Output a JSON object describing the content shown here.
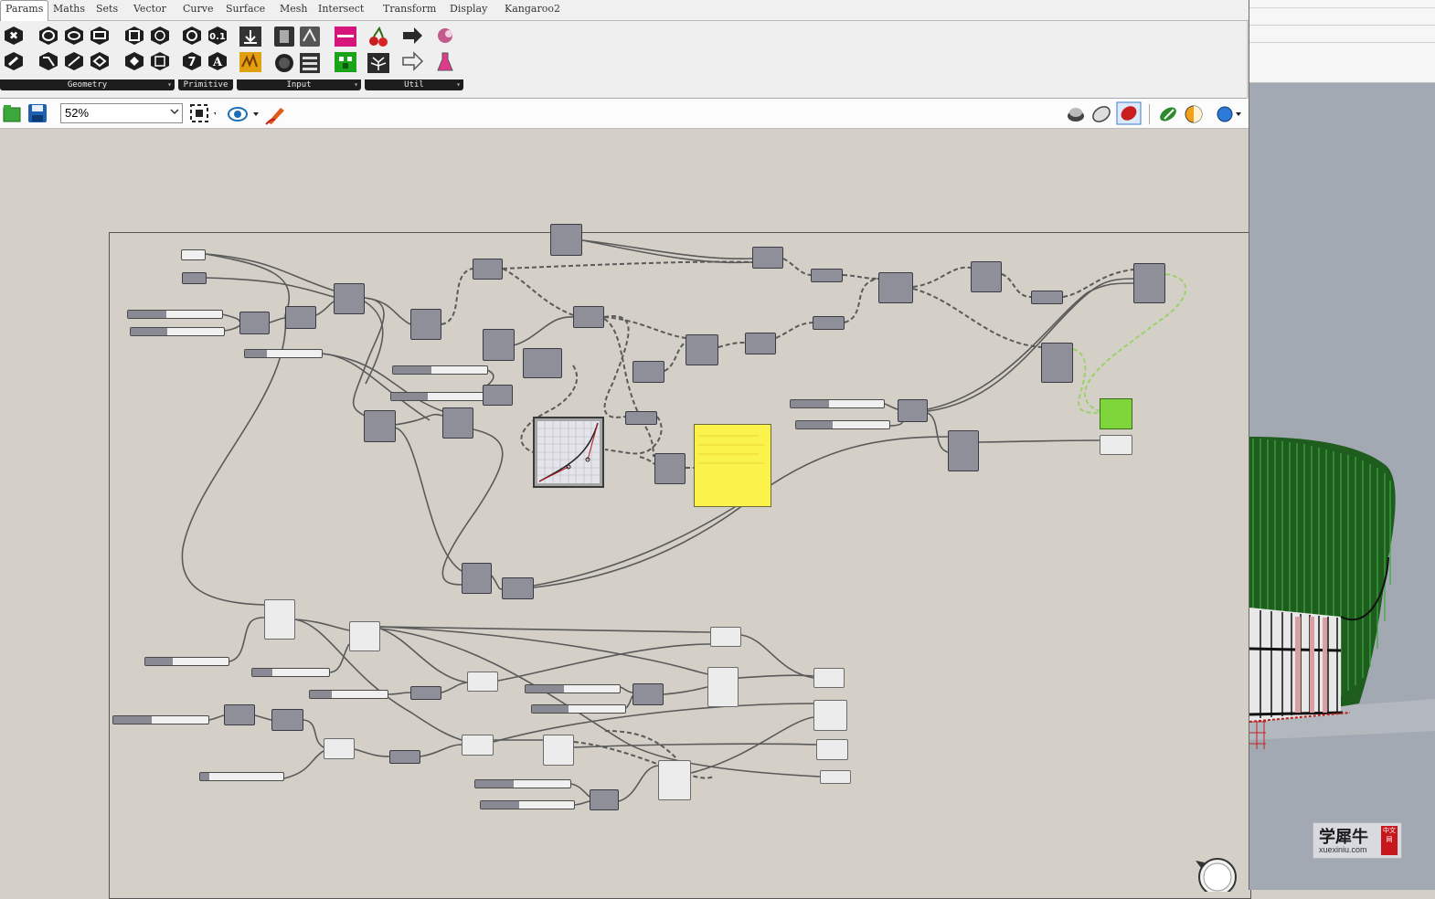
{
  "tabs": [
    {
      "label": "Params",
      "active": true
    },
    {
      "label": "Maths"
    },
    {
      "label": "Sets"
    },
    {
      "label": "Vector"
    },
    {
      "label": "Curve"
    },
    {
      "label": "Surface"
    },
    {
      "label": "Mesh"
    },
    {
      "label": "Intersect"
    },
    {
      "label": "Transform"
    },
    {
      "label": "Display"
    },
    {
      "label": "Kangaroo2"
    }
  ],
  "ribbon_panels": [
    {
      "label": "Geometry"
    },
    {
      "label": "Primitive"
    },
    {
      "label": "Input"
    },
    {
      "label": "Util"
    }
  ],
  "primitive_icons": {
    "number": "0.1",
    "integer": "7",
    "text": "A"
  },
  "toolbar": {
    "zoom_value": "52%",
    "icons": [
      "open-file-icon",
      "save-file-icon",
      "zoom-extents-icon",
      "preview-eye-icon",
      "sketch-pen-icon",
      "preview-wire-icon",
      "preview-mesh-icon",
      "preview-selected-icon",
      "bake-icon",
      "shade-icon",
      "sphere-display-icon"
    ]
  },
  "colors": {
    "canvas": "#d4d0c8",
    "component": "#8f8f9a",
    "panel": "#fbf24b",
    "selected_green": "#7ed63a",
    "wire": "#5a5a5a",
    "rhino_mesh_green": "#1f7a1f"
  },
  "watermark": {
    "main": "学犀牛",
    "sub": "xuexiniu.com",
    "badge": "中文网"
  }
}
